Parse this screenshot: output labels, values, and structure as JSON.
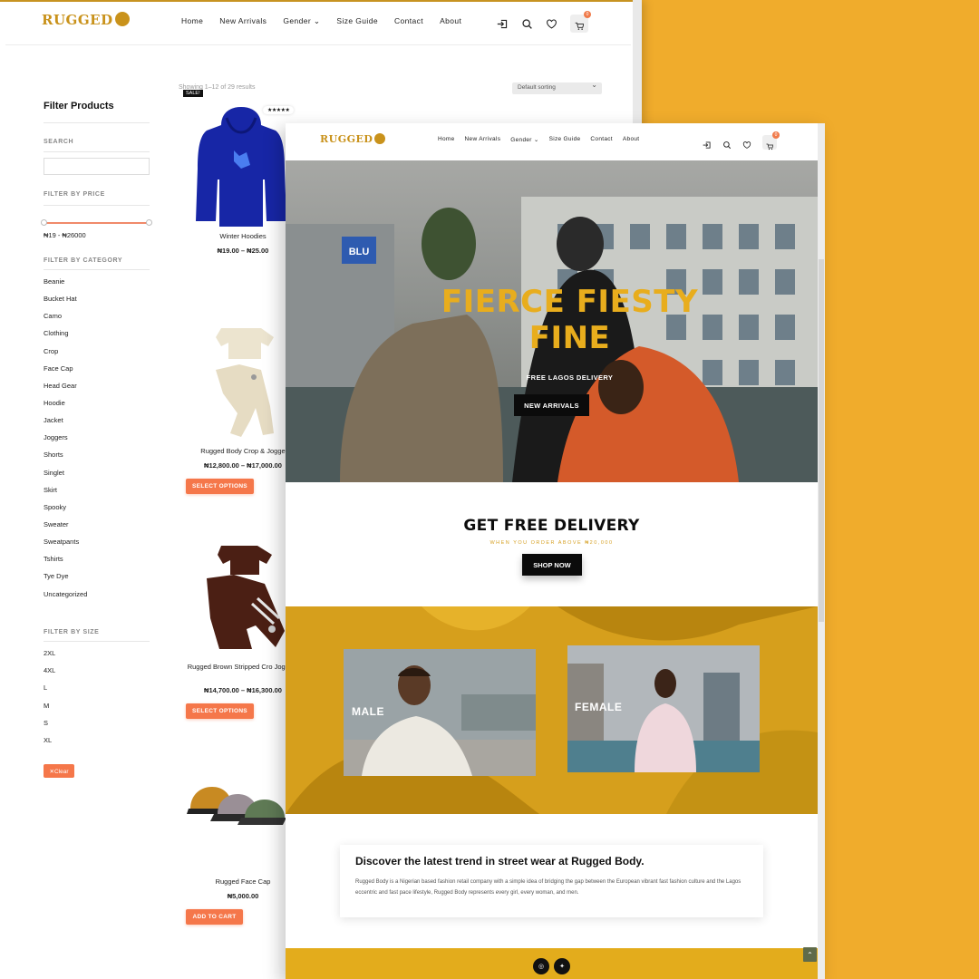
{
  "brand": {
    "logo_text": "RUGGED",
    "accent": "#e8ad1d",
    "button_orange": "#f5774a",
    "background": "#f0ac2c"
  },
  "nav": {
    "items": [
      "Home",
      "New Arrivals",
      "Gender ⌄",
      "Size Guide",
      "Contact",
      "About"
    ],
    "cart_count": "0"
  },
  "shop": {
    "filter_title": "Filter Products",
    "search_label": "SEARCH",
    "price_label": "FILTER BY PRICE",
    "price_range": "₦19 - ₦26000",
    "category_label": "FILTER BY CATEGORY",
    "categories": [
      "Beanie",
      "Bucket Hat",
      "Camo",
      "Clothing",
      "Crop",
      "Face Cap",
      "Head Gear",
      "Hoodie",
      "Jacket",
      "Joggers",
      "Shorts",
      "Singlet",
      "Skirt",
      "Spooky",
      "Sweater",
      "Sweatpants",
      "Tshirts",
      "Tye Dye",
      "Uncategorized"
    ],
    "size_label": "FILTER BY SIZE",
    "sizes": [
      "2XL",
      "4XL",
      "L",
      "M",
      "S",
      "XL"
    ],
    "clear_label": "✕Clear",
    "result_count": "Showing 1–12 of 29 results",
    "sort": "Default sorting",
    "sale_badge": "SALE!",
    "rating": "★★★★★",
    "products": [
      {
        "name": "Winter Hoodies",
        "price": "₦19.00 – ₦25.00",
        "button": ""
      },
      {
        "name": "Rugged Body Crop & Jogge",
        "price": "₦12,800.00 – ₦17,000.00",
        "button": "SELECT OPTIONS"
      },
      {
        "name": "Rugged Brown Stripped Cro Joggers",
        "price": "₦14,700.00 – ₦16,300.00",
        "button": "SELECT OPTIONS"
      },
      {
        "name": "Rugged Face Cap",
        "price": "₦5,000.00",
        "button": "ADD TO CART"
      }
    ]
  },
  "home": {
    "hero_title_1": "FIERCE FIESTY",
    "hero_title_2": "FINE",
    "hero_sub": "FREE LAGOS DELIVERY",
    "hero_button": "NEW ARRIVALS",
    "hero_sign": "BLU",
    "delivery_title": "GET FREE DELIVERY",
    "delivery_sub": "WHEN YOU ORDER ABOVE ₦20,000",
    "delivery_button": "SHOP NOW",
    "male_label": "MALE",
    "female_label": "FEMALE",
    "about_title": "Discover the latest trend in street wear at Rugged Body.",
    "about_text": "Rugged Body is a Nigerian based fashion retail company with a simple idea of bridging the gap between the European vibrant fast fashion culture and the Lagos eccentric and fast pace lifestyle, Rugged Body represents every girl, every woman, and men.",
    "social": [
      "◎",
      "✦"
    ],
    "to_top": "⌃"
  }
}
